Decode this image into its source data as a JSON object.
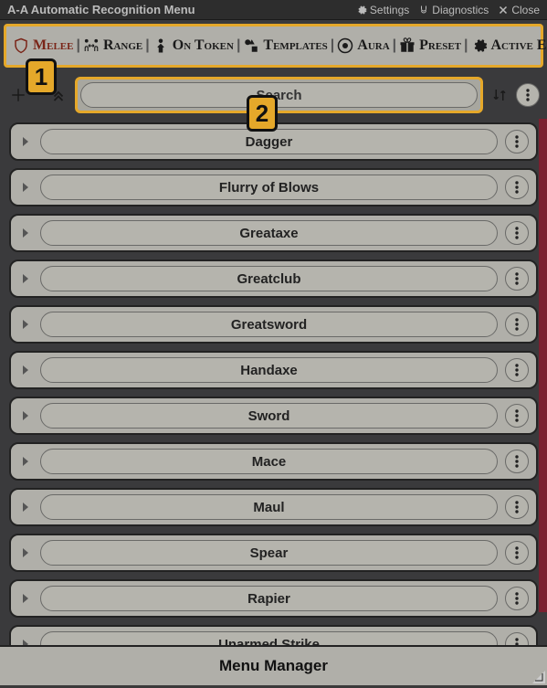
{
  "titlebar": {
    "title": "A-A Automatic Recognition Menu",
    "settings": "Settings",
    "diagnostics": "Diagnostics",
    "close": "Close"
  },
  "tabs": {
    "melee": "Melee",
    "range": "Range",
    "on_token": "On Token",
    "templates": "Templates",
    "aura": "Aura",
    "preset": "Preset",
    "active_effects": "Active Effects"
  },
  "search": {
    "placeholder": "Search"
  },
  "items": [
    {
      "label": "Dagger"
    },
    {
      "label": "Flurry of Blows"
    },
    {
      "label": "Greataxe"
    },
    {
      "label": "Greatclub"
    },
    {
      "label": "Greatsword"
    },
    {
      "label": "Handaxe"
    },
    {
      "label": "Sword"
    },
    {
      "label": "Mace"
    },
    {
      "label": "Maul"
    },
    {
      "label": "Spear"
    },
    {
      "label": "Rapier"
    },
    {
      "label": "Unarmed Strike"
    }
  ],
  "footer": {
    "label": "Menu Manager"
  },
  "callouts": {
    "one": "1",
    "two": "2"
  }
}
